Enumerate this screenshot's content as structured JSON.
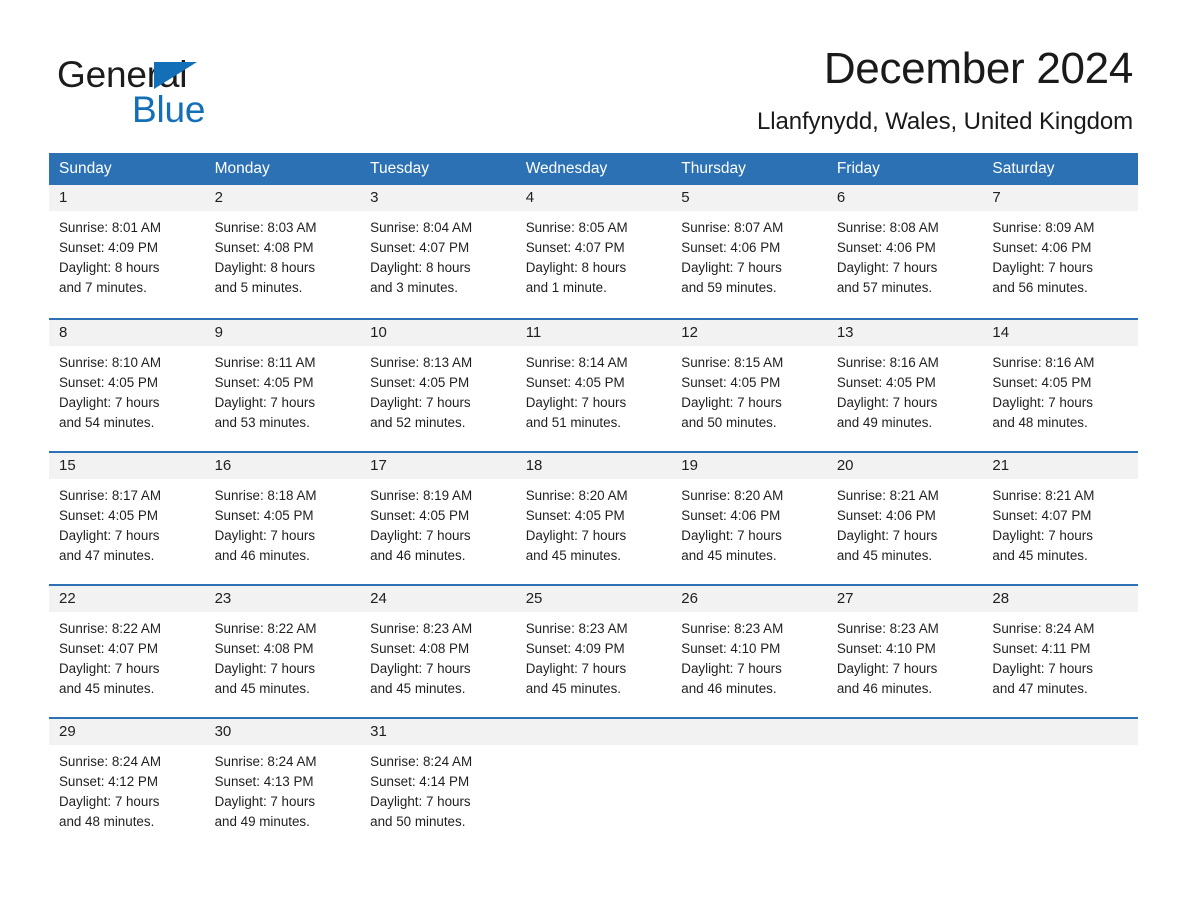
{
  "brand": {
    "name_part1": "General",
    "name_part2": "Blue",
    "triangle_color": "#136fb7",
    "blue_color": "#136fb7"
  },
  "header": {
    "title": "December 2024",
    "location": "Llanfynydd, Wales, United Kingdom"
  },
  "theme": {
    "header_blue": "#2c71b4",
    "day_band_gray": "#f2f2f2",
    "text_color": "#1f1f1f"
  },
  "weekdays": [
    "Sunday",
    "Monday",
    "Tuesday",
    "Wednesday",
    "Thursday",
    "Friday",
    "Saturday"
  ],
  "weeks": [
    [
      {
        "day": "1",
        "sunrise": "Sunrise: 8:01 AM",
        "sunset": "Sunset: 4:09 PM",
        "daylight_line1": "Daylight: 8 hours",
        "daylight_line2": "and 7 minutes."
      },
      {
        "day": "2",
        "sunrise": "Sunrise: 8:03 AM",
        "sunset": "Sunset: 4:08 PM",
        "daylight_line1": "Daylight: 8 hours",
        "daylight_line2": "and 5 minutes."
      },
      {
        "day": "3",
        "sunrise": "Sunrise: 8:04 AM",
        "sunset": "Sunset: 4:07 PM",
        "daylight_line1": "Daylight: 8 hours",
        "daylight_line2": "and 3 minutes."
      },
      {
        "day": "4",
        "sunrise": "Sunrise: 8:05 AM",
        "sunset": "Sunset: 4:07 PM",
        "daylight_line1": "Daylight: 8 hours",
        "daylight_line2": "and 1 minute."
      },
      {
        "day": "5",
        "sunrise": "Sunrise: 8:07 AM",
        "sunset": "Sunset: 4:06 PM",
        "daylight_line1": "Daylight: 7 hours",
        "daylight_line2": "and 59 minutes."
      },
      {
        "day": "6",
        "sunrise": "Sunrise: 8:08 AM",
        "sunset": "Sunset: 4:06 PM",
        "daylight_line1": "Daylight: 7 hours",
        "daylight_line2": "and 57 minutes."
      },
      {
        "day": "7",
        "sunrise": "Sunrise: 8:09 AM",
        "sunset": "Sunset: 4:06 PM",
        "daylight_line1": "Daylight: 7 hours",
        "daylight_line2": "and 56 minutes."
      }
    ],
    [
      {
        "day": "8",
        "sunrise": "Sunrise: 8:10 AM",
        "sunset": "Sunset: 4:05 PM",
        "daylight_line1": "Daylight: 7 hours",
        "daylight_line2": "and 54 minutes."
      },
      {
        "day": "9",
        "sunrise": "Sunrise: 8:11 AM",
        "sunset": "Sunset: 4:05 PM",
        "daylight_line1": "Daylight: 7 hours",
        "daylight_line2": "and 53 minutes."
      },
      {
        "day": "10",
        "sunrise": "Sunrise: 8:13 AM",
        "sunset": "Sunset: 4:05 PM",
        "daylight_line1": "Daylight: 7 hours",
        "daylight_line2": "and 52 minutes."
      },
      {
        "day": "11",
        "sunrise": "Sunrise: 8:14 AM",
        "sunset": "Sunset: 4:05 PM",
        "daylight_line1": "Daylight: 7 hours",
        "daylight_line2": "and 51 minutes."
      },
      {
        "day": "12",
        "sunrise": "Sunrise: 8:15 AM",
        "sunset": "Sunset: 4:05 PM",
        "daylight_line1": "Daylight: 7 hours",
        "daylight_line2": "and 50 minutes."
      },
      {
        "day": "13",
        "sunrise": "Sunrise: 8:16 AM",
        "sunset": "Sunset: 4:05 PM",
        "daylight_line1": "Daylight: 7 hours",
        "daylight_line2": "and 49 minutes."
      },
      {
        "day": "14",
        "sunrise": "Sunrise: 8:16 AM",
        "sunset": "Sunset: 4:05 PM",
        "daylight_line1": "Daylight: 7 hours",
        "daylight_line2": "and 48 minutes."
      }
    ],
    [
      {
        "day": "15",
        "sunrise": "Sunrise: 8:17 AM",
        "sunset": "Sunset: 4:05 PM",
        "daylight_line1": "Daylight: 7 hours",
        "daylight_line2": "and 47 minutes."
      },
      {
        "day": "16",
        "sunrise": "Sunrise: 8:18 AM",
        "sunset": "Sunset: 4:05 PM",
        "daylight_line1": "Daylight: 7 hours",
        "daylight_line2": "and 46 minutes."
      },
      {
        "day": "17",
        "sunrise": "Sunrise: 8:19 AM",
        "sunset": "Sunset: 4:05 PM",
        "daylight_line1": "Daylight: 7 hours",
        "daylight_line2": "and 46 minutes."
      },
      {
        "day": "18",
        "sunrise": "Sunrise: 8:20 AM",
        "sunset": "Sunset: 4:05 PM",
        "daylight_line1": "Daylight: 7 hours",
        "daylight_line2": "and 45 minutes."
      },
      {
        "day": "19",
        "sunrise": "Sunrise: 8:20 AM",
        "sunset": "Sunset: 4:06 PM",
        "daylight_line1": "Daylight: 7 hours",
        "daylight_line2": "and 45 minutes."
      },
      {
        "day": "20",
        "sunrise": "Sunrise: 8:21 AM",
        "sunset": "Sunset: 4:06 PM",
        "daylight_line1": "Daylight: 7 hours",
        "daylight_line2": "and 45 minutes."
      },
      {
        "day": "21",
        "sunrise": "Sunrise: 8:21 AM",
        "sunset": "Sunset: 4:07 PM",
        "daylight_line1": "Daylight: 7 hours",
        "daylight_line2": "and 45 minutes."
      }
    ],
    [
      {
        "day": "22",
        "sunrise": "Sunrise: 8:22 AM",
        "sunset": "Sunset: 4:07 PM",
        "daylight_line1": "Daylight: 7 hours",
        "daylight_line2": "and 45 minutes."
      },
      {
        "day": "23",
        "sunrise": "Sunrise: 8:22 AM",
        "sunset": "Sunset: 4:08 PM",
        "daylight_line1": "Daylight: 7 hours",
        "daylight_line2": "and 45 minutes."
      },
      {
        "day": "24",
        "sunrise": "Sunrise: 8:23 AM",
        "sunset": "Sunset: 4:08 PM",
        "daylight_line1": "Daylight: 7 hours",
        "daylight_line2": "and 45 minutes."
      },
      {
        "day": "25",
        "sunrise": "Sunrise: 8:23 AM",
        "sunset": "Sunset: 4:09 PM",
        "daylight_line1": "Daylight: 7 hours",
        "daylight_line2": "and 45 minutes."
      },
      {
        "day": "26",
        "sunrise": "Sunrise: 8:23 AM",
        "sunset": "Sunset: 4:10 PM",
        "daylight_line1": "Daylight: 7 hours",
        "daylight_line2": "and 46 minutes."
      },
      {
        "day": "27",
        "sunrise": "Sunrise: 8:23 AM",
        "sunset": "Sunset: 4:10 PM",
        "daylight_line1": "Daylight: 7 hours",
        "daylight_line2": "and 46 minutes."
      },
      {
        "day": "28",
        "sunrise": "Sunrise: 8:24 AM",
        "sunset": "Sunset: 4:11 PM",
        "daylight_line1": "Daylight: 7 hours",
        "daylight_line2": "and 47 minutes."
      }
    ],
    [
      {
        "day": "29",
        "sunrise": "Sunrise: 8:24 AM",
        "sunset": "Sunset: 4:12 PM",
        "daylight_line1": "Daylight: 7 hours",
        "daylight_line2": "and 48 minutes."
      },
      {
        "day": "30",
        "sunrise": "Sunrise: 8:24 AM",
        "sunset": "Sunset: 4:13 PM",
        "daylight_line1": "Daylight: 7 hours",
        "daylight_line2": "and 49 minutes."
      },
      {
        "day": "31",
        "sunrise": "Sunrise: 8:24 AM",
        "sunset": "Sunset: 4:14 PM",
        "daylight_line1": "Daylight: 7 hours",
        "daylight_line2": "and 50 minutes."
      },
      {
        "day": "",
        "sunrise": "",
        "sunset": "",
        "daylight_line1": "",
        "daylight_line2": ""
      },
      {
        "day": "",
        "sunrise": "",
        "sunset": "",
        "daylight_line1": "",
        "daylight_line2": ""
      },
      {
        "day": "",
        "sunrise": "",
        "sunset": "",
        "daylight_line1": "",
        "daylight_line2": ""
      },
      {
        "day": "",
        "sunrise": "",
        "sunset": "",
        "daylight_line1": "",
        "daylight_line2": ""
      }
    ]
  ]
}
